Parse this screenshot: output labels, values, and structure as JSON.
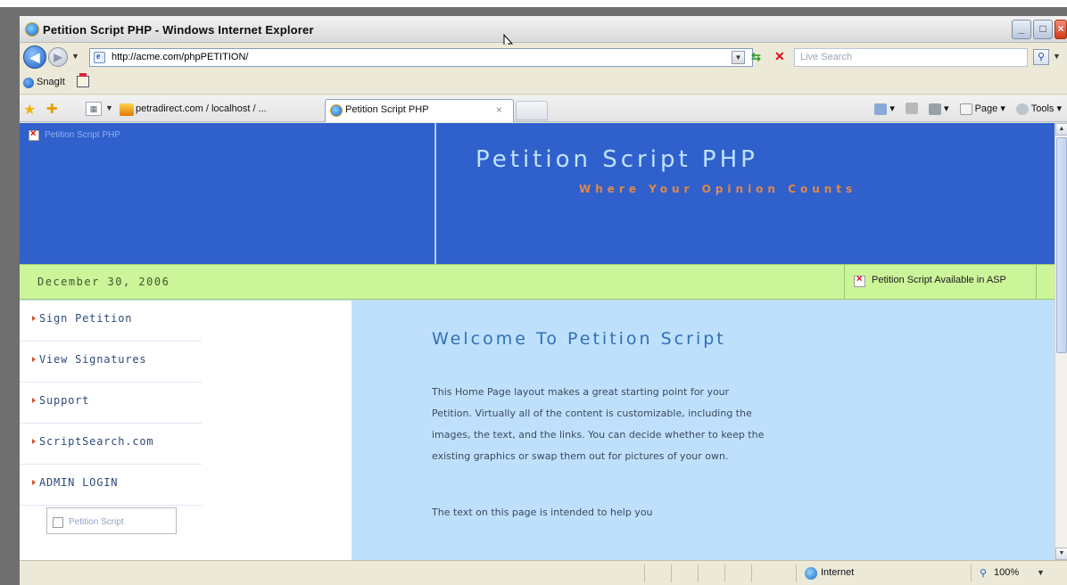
{
  "window": {
    "title": "Petition Script PHP - Windows Internet Explorer",
    "buttons": {
      "minimize": "_",
      "maximize": "□",
      "close": "×"
    }
  },
  "address": {
    "url": "http://acme.com/phpPETITION/",
    "search_placeholder": "Live Search"
  },
  "links_bar": {
    "snagit_label": "SnagIt"
  },
  "tabs": [
    {
      "label": "petradirect.com / localhost / ..."
    },
    {
      "label": "Petition Script PHP",
      "close": "×"
    }
  ],
  "command_bar": {
    "page_label": "Page",
    "tools_label": "Tools"
  },
  "page": {
    "logo_alt": "Petition Script PHP",
    "site_title": "Petition Script PHP",
    "tagline": "Where Your Opinion Counts",
    "date": "December 30, 2006",
    "asp_notice": "Petition Script Available in ASP",
    "nav": [
      {
        "label": "Sign Petition"
      },
      {
        "label": "View Signatures"
      },
      {
        "label": "Support"
      },
      {
        "label": "ScriptSearch.com"
      },
      {
        "label": "ADMIN LOGIN"
      }
    ],
    "sidebar_image_alt": "Petition Script",
    "welcome_title": "Welcome To Petition Script",
    "welcome_body": "This Home Page layout makes a great starting point for your Petition. Virtually all of the content is customizable, including the images, the text, and the links. You can decide whether to keep the existing graphics or swap them out for pictures of your own.",
    "welcome_body_2": "The text on this page is intended to help you"
  },
  "status": {
    "zone": "Internet",
    "zoom": "100%"
  },
  "colors": {
    "header_blue": "#3060cc",
    "date_bar_green": "#ccf59a",
    "content_bg": "#bfe0fc",
    "tagline_orange": "#e0894a"
  }
}
